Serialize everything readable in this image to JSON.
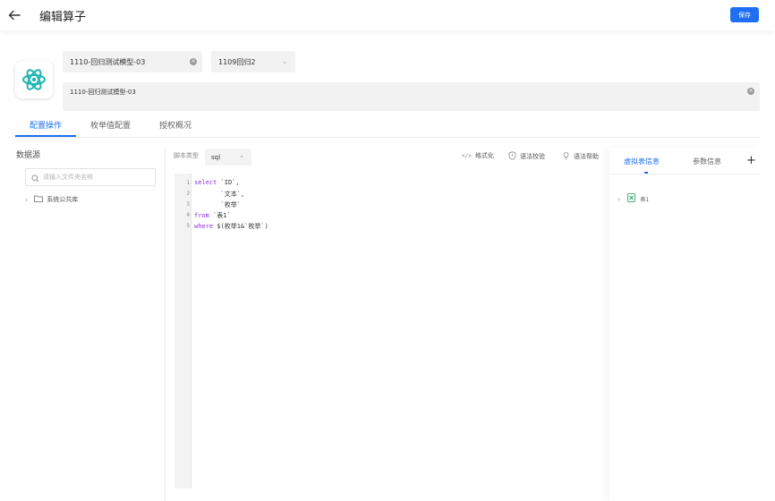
{
  "header": {
    "title": "编辑算子",
    "save_label": "保存"
  },
  "operator": {
    "name": "1110-回归测试模型-03",
    "version": "1109回归2",
    "description": "1110-回归测试模型-03"
  },
  "tabs": [
    {
      "label": "配置操作"
    },
    {
      "label": "枚举值配置"
    },
    {
      "label": "授权概况"
    }
  ],
  "datasource": {
    "title": "数据源",
    "search_placeholder": "请输入文件夹名称",
    "tree": [
      {
        "label": "系统公共库"
      }
    ]
  },
  "editor": {
    "script_type_label": "脚本类型",
    "script_type": "sql",
    "tools": {
      "format": "格式化",
      "check": "语法校验",
      "help": "语法帮助"
    },
    "line_numbers": [
      "1",
      "2",
      "3",
      "4",
      "5"
    ],
    "lines": [
      {
        "kw": "select",
        "rest": " `ID`,"
      },
      {
        "kw": "",
        "rest": "       `文本`,"
      },
      {
        "kw": "",
        "rest": "       `枚举`"
      },
      {
        "kw": "from",
        "rest": " `表1`"
      },
      {
        "kw": "where",
        "rest": " $(枚举1&`枚举`)"
      }
    ]
  },
  "right_panel": {
    "tabs": [
      {
        "label": "虚拟表信息"
      },
      {
        "label": "参数信息"
      }
    ],
    "add_label": "+",
    "tables": [
      {
        "label": "表1"
      }
    ]
  },
  "colors": {
    "accent": "#1e6ff1"
  }
}
